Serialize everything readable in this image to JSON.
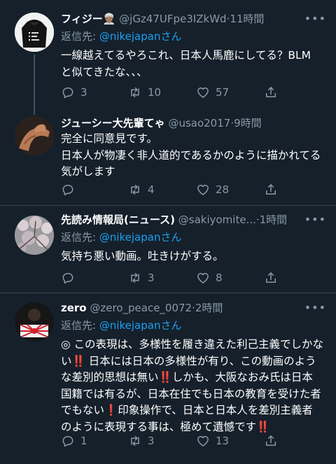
{
  "tweets": [
    {
      "name": "フィジー👳🏽",
      "handle": "@jGz47UFpe3IZkWd",
      "time": "·11時間",
      "reply_prefix": "返信先: ",
      "reply_to": "@nikejapanさん",
      "text": "一線越えてるやろこれ、日本人馬鹿にしてる？BLM と似てきたな、、、",
      "replies": "3",
      "retweets": "10",
      "likes": "57"
    },
    {
      "name": "ジューシー大先輩てゃ",
      "handle": "@usao2017",
      "time": "·9時間",
      "text": "完全に同意見です。\n日本人が物凄く非人道的であるかのように描かれてる気がします",
      "replies": "",
      "retweets": "4",
      "likes": "28"
    },
    {
      "name": "先読み情報局(ニュース)",
      "handle": "@sakiyomite...",
      "time": "·1時間",
      "reply_prefix": "返信先: ",
      "reply_to": "@nikejapanさん",
      "text": "気持ち悪い動画。吐きけがする。",
      "replies": "",
      "retweets": "3",
      "likes": "8"
    },
    {
      "name": "zero",
      "handle": "@zero_peace_0072",
      "time": "·2時間",
      "reply_prefix": "返信先: ",
      "reply_to": "@nikejapanさん",
      "text_parts": [
        "◎ この表現は、多様性を履き違えた利己主義でしかない",
        "‼️",
        " 日本には日本の多様性が有り、この動画のような差別的思想は無い",
        "‼️",
        "しかも、大阪なおみ氏は日本国籍では有るが、日本在住でも日本の教育を受けた者でもない",
        "❗️",
        "印象操作で、日本と日本人を差別主義者のように表現する事は、極めて遺憾です",
        "‼️"
      ],
      "replies": "1",
      "retweets": "3",
      "likes": "13"
    }
  ],
  "icons": {
    "more": "more-horizontal-icon",
    "reply": "reply-icon",
    "retweet": "retweet-icon",
    "like": "heart-icon",
    "share": "share-icon"
  },
  "colors": {
    "background": "#15202b",
    "secondary_text": "#8899a6",
    "link": "#1da1f2",
    "divider": "#38444d"
  }
}
